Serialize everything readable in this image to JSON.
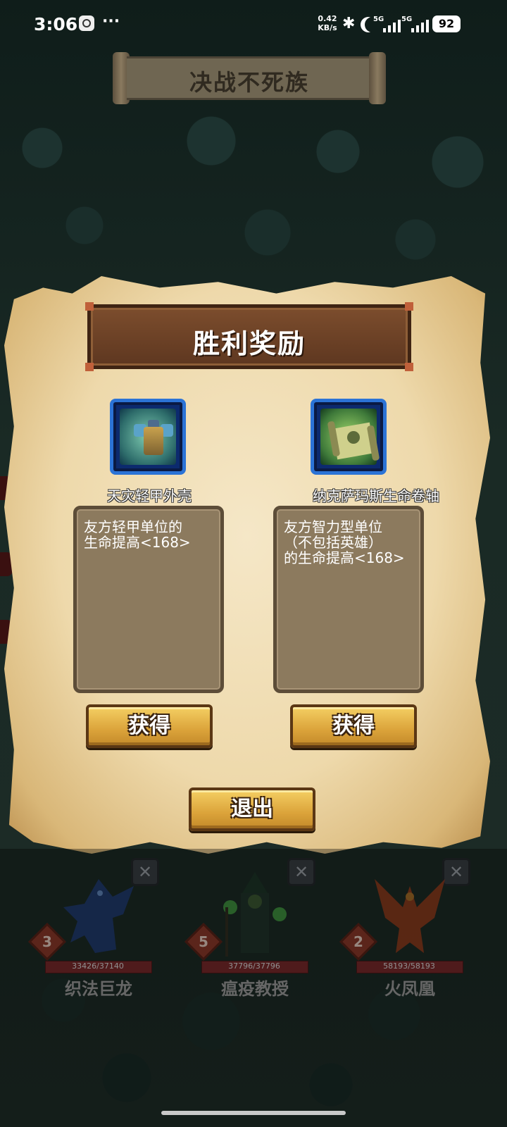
{
  "status_bar": {
    "time": "3:06",
    "overflow": "···",
    "net_speed_value": "0.42",
    "net_speed_unit": "KB/s",
    "signal1_label": "5G",
    "signal2_label": "5G",
    "battery": "92"
  },
  "banner": {
    "title": "决战不死族"
  },
  "panel": {
    "title": "胜利奖励",
    "rewards": [
      {
        "name": "天灾轻甲外壳",
        "icon": "armor-icon",
        "desc_lines": [
          "友方轻甲单位的",
          "生命提高<168>"
        ],
        "button": "获得"
      },
      {
        "name": "纳克萨玛斯生命卷轴",
        "icon": "scroll-icon",
        "desc_lines": [
          "友方智力型单位",
          "（不包括英雄）",
          "的生命提高<168>"
        ],
        "button": "获得"
      }
    ],
    "exit_button": "退出"
  },
  "units": [
    {
      "name": "织法巨龙",
      "level": "3",
      "hp": "33426/37140",
      "hp_fraction": 0.9,
      "close": "✕"
    },
    {
      "name": "瘟疫教授",
      "level": "5",
      "hp": "37796/37796",
      "hp_fraction": 1.0,
      "close": "✕"
    },
    {
      "name": "火凤凰",
      "level": "2",
      "hp": "58193/58193",
      "hp_fraction": 1.0,
      "close": "✕"
    }
  ],
  "colors": {
    "gold_button": "#dba33a",
    "header_brown": "#6d4226",
    "icon_frame_blue": "#2b73d6",
    "parchment": "#eed9ab"
  }
}
